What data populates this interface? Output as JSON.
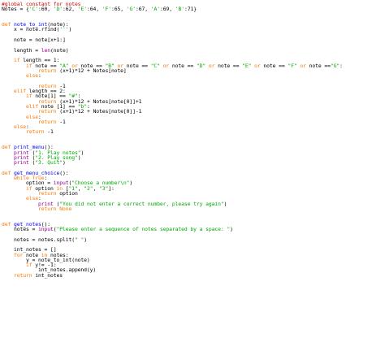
{
  "editor": {
    "theme_colors": {
      "keyword": "#ff7700",
      "builtin": "#900090",
      "string": "#00aa00",
      "comment": "#dd0000",
      "definition": "#0000ff",
      "default": "#000000",
      "background": "#ffffff"
    },
    "lines": [
      [
        {
          "t": "#global constant for notes",
          "c": "cmt"
        }
      ],
      [
        {
          "t": "Notes = {",
          "c": "pl"
        },
        {
          "t": "'C'",
          "c": "str"
        },
        {
          "t": ":60, ",
          "c": "pl"
        },
        {
          "t": "'D'",
          "c": "str"
        },
        {
          "t": ":62, ",
          "c": "pl"
        },
        {
          "t": "'E'",
          "c": "str"
        },
        {
          "t": ":64, ",
          "c": "pl"
        },
        {
          "t": "'F'",
          "c": "str"
        },
        {
          "t": ":65, ",
          "c": "pl"
        },
        {
          "t": "'G'",
          "c": "str"
        },
        {
          "t": ":67, ",
          "c": "pl"
        },
        {
          "t": "'A'",
          "c": "str"
        },
        {
          "t": ":69, ",
          "c": "pl"
        },
        {
          "t": "'B'",
          "c": "str"
        },
        {
          "t": ":71}",
          "c": "pl"
        }
      ],
      [],
      [],
      [
        {
          "t": "def ",
          "c": "kw"
        },
        {
          "t": "note_to_int",
          "c": "def"
        },
        {
          "t": "(note):",
          "c": "pl"
        }
      ],
      [
        {
          "t": "    x = note.rfind(",
          "c": "pl"
        },
        {
          "t": "'''",
          "c": "str"
        },
        {
          "t": ")",
          "c": "pl"
        }
      ],
      [],
      [
        {
          "t": "    note = note[x+1:]",
          "c": "pl"
        }
      ],
      [],
      [
        {
          "t": "    length = ",
          "c": "pl"
        },
        {
          "t": "len",
          "c": "bi"
        },
        {
          "t": "(note)",
          "c": "pl"
        }
      ],
      [],
      [
        {
          "t": "    ",
          "c": "pl"
        },
        {
          "t": "if",
          "c": "kw"
        },
        {
          "t": " length == 1:",
          "c": "pl"
        }
      ],
      [
        {
          "t": "        ",
          "c": "pl"
        },
        {
          "t": "if",
          "c": "kw"
        },
        {
          "t": " note == ",
          "c": "pl"
        },
        {
          "t": "\"A\"",
          "c": "str"
        },
        {
          "t": " ",
          "c": "pl"
        },
        {
          "t": "or",
          "c": "kw"
        },
        {
          "t": " note == ",
          "c": "pl"
        },
        {
          "t": "\"B\"",
          "c": "str"
        },
        {
          "t": " ",
          "c": "pl"
        },
        {
          "t": "or",
          "c": "kw"
        },
        {
          "t": " note == ",
          "c": "pl"
        },
        {
          "t": "\"C\"",
          "c": "str"
        },
        {
          "t": " ",
          "c": "pl"
        },
        {
          "t": "or",
          "c": "kw"
        },
        {
          "t": " note == ",
          "c": "pl"
        },
        {
          "t": "\"D\"",
          "c": "str"
        },
        {
          "t": " ",
          "c": "pl"
        },
        {
          "t": "or",
          "c": "kw"
        },
        {
          "t": " note == ",
          "c": "pl"
        },
        {
          "t": "\"E\"",
          "c": "str"
        },
        {
          "t": " ",
          "c": "pl"
        },
        {
          "t": "or",
          "c": "kw"
        },
        {
          "t": " note == ",
          "c": "pl"
        },
        {
          "t": "\"F\"",
          "c": "str"
        },
        {
          "t": " ",
          "c": "pl"
        },
        {
          "t": "or",
          "c": "kw"
        },
        {
          "t": " note ==",
          "c": "pl"
        },
        {
          "t": "\"G\"",
          "c": "str"
        },
        {
          "t": ":",
          "c": "pl"
        }
      ],
      [
        {
          "t": "            ",
          "c": "pl"
        },
        {
          "t": "return",
          "c": "kw"
        },
        {
          "t": " (x+1)*12 + Notes[note]",
          "c": "pl"
        }
      ],
      [
        {
          "t": "        ",
          "c": "pl"
        },
        {
          "t": "else",
          "c": "kw"
        },
        {
          "t": ":",
          "c": "pl"
        }
      ],
      [],
      [
        {
          "t": "            ",
          "c": "pl"
        },
        {
          "t": "return",
          "c": "kw"
        },
        {
          "t": " -1",
          "c": "pl"
        }
      ],
      [
        {
          "t": "    ",
          "c": "pl"
        },
        {
          "t": "elif",
          "c": "kw"
        },
        {
          "t": " length == 2:",
          "c": "pl"
        }
      ],
      [
        {
          "t": "        ",
          "c": "pl"
        },
        {
          "t": "if",
          "c": "kw"
        },
        {
          "t": " note[1] == ",
          "c": "pl"
        },
        {
          "t": "\"#\"",
          "c": "str"
        },
        {
          "t": ":",
          "c": "pl"
        }
      ],
      [
        {
          "t": "            ",
          "c": "pl"
        },
        {
          "t": "return",
          "c": "kw"
        },
        {
          "t": " (x+1)*12 + Notes[note[0]]+1",
          "c": "pl"
        }
      ],
      [
        {
          "t": "        ",
          "c": "pl"
        },
        {
          "t": "elif",
          "c": "kw"
        },
        {
          "t": " note [1] == ",
          "c": "pl"
        },
        {
          "t": "\"b\"",
          "c": "str"
        },
        {
          "t": ":",
          "c": "pl"
        }
      ],
      [
        {
          "t": "            ",
          "c": "pl"
        },
        {
          "t": "return",
          "c": "kw"
        },
        {
          "t": " (x+1)*12 + Notes[note[0]]-1",
          "c": "pl"
        }
      ],
      [
        {
          "t": "        ",
          "c": "pl"
        },
        {
          "t": "else",
          "c": "kw"
        },
        {
          "t": ":",
          "c": "pl"
        }
      ],
      [
        {
          "t": "            ",
          "c": "pl"
        },
        {
          "t": "return",
          "c": "kw"
        },
        {
          "t": " -1",
          "c": "pl"
        }
      ],
      [
        {
          "t": "    ",
          "c": "pl"
        },
        {
          "t": "else",
          "c": "kw"
        },
        {
          "t": ":",
          "c": "pl"
        }
      ],
      [
        {
          "t": "        ",
          "c": "pl"
        },
        {
          "t": "return",
          "c": "kw"
        },
        {
          "t": " -1",
          "c": "pl"
        }
      ],
      [],
      [],
      [
        {
          "t": "def ",
          "c": "kw"
        },
        {
          "t": "print_menu",
          "c": "def"
        },
        {
          "t": "():",
          "c": "pl"
        }
      ],
      [
        {
          "t": "    ",
          "c": "pl"
        },
        {
          "t": "print",
          "c": "bi"
        },
        {
          "t": " (",
          "c": "pl"
        },
        {
          "t": "\"1. Play notes\"",
          "c": "str"
        },
        {
          "t": ")",
          "c": "pl"
        }
      ],
      [
        {
          "t": "    ",
          "c": "pl"
        },
        {
          "t": "print",
          "c": "bi"
        },
        {
          "t": " (",
          "c": "pl"
        },
        {
          "t": "\"2. Play song\"",
          "c": "str"
        },
        {
          "t": ")",
          "c": "pl"
        }
      ],
      [
        {
          "t": "    ",
          "c": "pl"
        },
        {
          "t": "print",
          "c": "bi"
        },
        {
          "t": " (",
          "c": "pl"
        },
        {
          "t": "\"3. Quit\"",
          "c": "str"
        },
        {
          "t": ")",
          "c": "pl"
        }
      ],
      [],
      [
        {
          "t": "def ",
          "c": "kw"
        },
        {
          "t": "get_menu_choice",
          "c": "def"
        },
        {
          "t": "():",
          "c": "pl"
        }
      ],
      [
        {
          "t": "    ",
          "c": "pl"
        },
        {
          "t": "while",
          "c": "kw"
        },
        {
          "t": " ",
          "c": "pl"
        },
        {
          "t": "True",
          "c": "kw"
        },
        {
          "t": ":",
          "c": "pl"
        }
      ],
      [
        {
          "t": "        option = ",
          "c": "pl"
        },
        {
          "t": "input",
          "c": "bi"
        },
        {
          "t": "(",
          "c": "pl"
        },
        {
          "t": "\"Choose a number\\n\"",
          "c": "str"
        },
        {
          "t": ")",
          "c": "pl"
        }
      ],
      [
        {
          "t": "        ",
          "c": "pl"
        },
        {
          "t": "if",
          "c": "kw"
        },
        {
          "t": " option ",
          "c": "pl"
        },
        {
          "t": "in",
          "c": "kw"
        },
        {
          "t": " [",
          "c": "pl"
        },
        {
          "t": "\"1\"",
          "c": "str"
        },
        {
          "t": ", ",
          "c": "pl"
        },
        {
          "t": "\"2\"",
          "c": "str"
        },
        {
          "t": ", ",
          "c": "pl"
        },
        {
          "t": "\"3\"",
          "c": "str"
        },
        {
          "t": "]:",
          "c": "pl"
        }
      ],
      [
        {
          "t": "            ",
          "c": "pl"
        },
        {
          "t": "return",
          "c": "kw"
        },
        {
          "t": " option",
          "c": "pl"
        }
      ],
      [
        {
          "t": "        ",
          "c": "pl"
        },
        {
          "t": "else",
          "c": "kw"
        },
        {
          "t": ":",
          "c": "pl"
        }
      ],
      [
        {
          "t": "            ",
          "c": "pl"
        },
        {
          "t": "print",
          "c": "bi"
        },
        {
          "t": " (",
          "c": "pl"
        },
        {
          "t": "\"You did not enter a correct number, please try again\"",
          "c": "str"
        },
        {
          "t": ")",
          "c": "pl"
        }
      ],
      [
        {
          "t": "            ",
          "c": "pl"
        },
        {
          "t": "return",
          "c": "kw"
        },
        {
          "t": " ",
          "c": "pl"
        },
        {
          "t": "None",
          "c": "kw"
        }
      ],
      [],
      [],
      [
        {
          "t": "def ",
          "c": "kw"
        },
        {
          "t": "get_notes",
          "c": "def"
        },
        {
          "t": "():",
          "c": "pl"
        }
      ],
      [
        {
          "t": "    notes = ",
          "c": "pl"
        },
        {
          "t": "input",
          "c": "bi"
        },
        {
          "t": "(",
          "c": "pl"
        },
        {
          "t": "\"Please enter a sequence of notes separated by a space: \"",
          "c": "str"
        },
        {
          "t": ")",
          "c": "pl"
        }
      ],
      [],
      [
        {
          "t": "    notes = notes.split(",
          "c": "pl"
        },
        {
          "t": "\" \"",
          "c": "str"
        },
        {
          "t": ")",
          "c": "pl"
        }
      ],
      [],
      [
        {
          "t": "    int_notes = []",
          "c": "pl"
        }
      ],
      [
        {
          "t": "    ",
          "c": "pl"
        },
        {
          "t": "for",
          "c": "kw"
        },
        {
          "t": " note ",
          "c": "pl"
        },
        {
          "t": "in",
          "c": "kw"
        },
        {
          "t": " notes:",
          "c": "pl"
        }
      ],
      [
        {
          "t": "        y = note_to_int(note)",
          "c": "pl"
        }
      ],
      [
        {
          "t": "        ",
          "c": "pl"
        },
        {
          "t": "if",
          "c": "kw"
        },
        {
          "t": " y!= -1:",
          "c": "pl"
        }
      ],
      [
        {
          "t": "            int_notes.append(y)",
          "c": "pl"
        }
      ],
      [
        {
          "t": "    ",
          "c": "pl"
        },
        {
          "t": "return",
          "c": "kw"
        },
        {
          "t": " int_notes",
          "c": "pl"
        }
      ]
    ]
  }
}
